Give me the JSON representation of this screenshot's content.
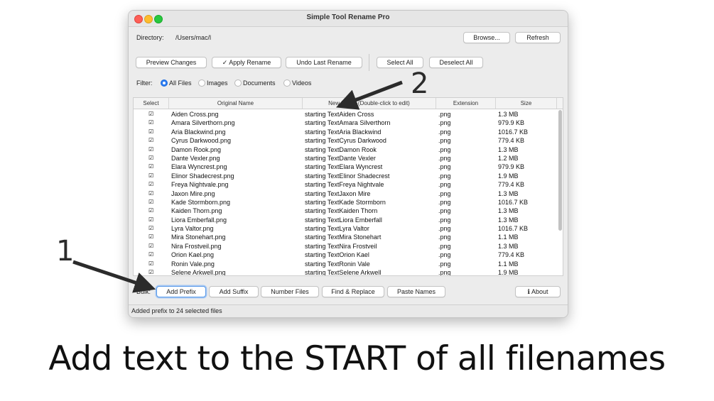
{
  "window": {
    "title": "Simple Tool Rename Pro"
  },
  "directory": {
    "label": "Directory:",
    "path": "/Users/mac/l"
  },
  "buttons": {
    "browse": "Browse...",
    "refresh": "Refresh",
    "preview": "Preview Changes",
    "apply": "✓ Apply Rename",
    "undo": "Undo Last Rename",
    "select_all": "Select All",
    "deselect_all": "Deselect All"
  },
  "filter": {
    "label": "Filter:",
    "options": [
      "All Files",
      "Images",
      "Documents",
      "Videos"
    ],
    "selected": "All Files"
  },
  "table": {
    "columns": [
      "Select",
      "Original Name",
      "New Name (Double-click to edit)",
      "Extension",
      "Size"
    ],
    "rows": [
      {
        "sel": "☑",
        "orig": "Aiden Cross.png",
        "new": "starting TextAiden Cross",
        "ext": ".png",
        "size": "1.3 MB"
      },
      {
        "sel": "☑",
        "orig": "Amara Silverthorn.png",
        "new": "starting TextAmara Silverthorn",
        "ext": ".png",
        "size": "979.9 KB"
      },
      {
        "sel": "☑",
        "orig": "Aria Blackwind.png",
        "new": "starting TextAria Blackwind",
        "ext": ".png",
        "size": "1016.7 KB"
      },
      {
        "sel": "☑",
        "orig": "Cyrus Darkwood.png",
        "new": "starting TextCyrus Darkwood",
        "ext": ".png",
        "size": "779.4 KB"
      },
      {
        "sel": "☑",
        "orig": "Damon Rook.png",
        "new": "starting TextDamon Rook",
        "ext": ".png",
        "size": "1.3 MB"
      },
      {
        "sel": "☑",
        "orig": "Dante Vexler.png",
        "new": "starting TextDante Vexler",
        "ext": ".png",
        "size": "1.2 MB"
      },
      {
        "sel": "☑",
        "orig": "Elara Wyncrest.png",
        "new": "starting TextElara Wyncrest",
        "ext": ".png",
        "size": "979.9 KB"
      },
      {
        "sel": "☑",
        "orig": "Elinor Shadecrest.png",
        "new": "starting TextElinor Shadecrest",
        "ext": ".png",
        "size": "1.9 MB"
      },
      {
        "sel": "☑",
        "orig": "Freya Nightvale.png",
        "new": "starting TextFreya Nightvale",
        "ext": ".png",
        "size": "779.4 KB"
      },
      {
        "sel": "☑",
        "orig": "Jaxon Mire.png",
        "new": "starting TextJaxon Mire",
        "ext": ".png",
        "size": "1.3 MB"
      },
      {
        "sel": "☑",
        "orig": "Kade Stormborn.png",
        "new": "starting TextKade Stormborn",
        "ext": ".png",
        "size": "1016.7 KB"
      },
      {
        "sel": "☑",
        "orig": "Kaiden Thorn.png",
        "new": "starting TextKaiden Thorn",
        "ext": ".png",
        "size": "1.3 MB"
      },
      {
        "sel": "☑",
        "orig": "Liora Emberfall.png",
        "new": "starting TextLiora Emberfall",
        "ext": ".png",
        "size": "1.3 MB"
      },
      {
        "sel": "☑",
        "orig": "Lyra Valtor.png",
        "new": "starting TextLyra Valtor",
        "ext": ".png",
        "size": "1016.7 KB"
      },
      {
        "sel": "☑",
        "orig": "Mira Stonehart.png",
        "new": "starting TextMira Stonehart",
        "ext": ".png",
        "size": "1.1 MB"
      },
      {
        "sel": "☑",
        "orig": "Nira Frostveil.png",
        "new": "starting TextNira Frostveil",
        "ext": ".png",
        "size": "1.3 MB"
      },
      {
        "sel": "☑",
        "orig": "Orion Kael.png",
        "new": "starting TextOrion Kael",
        "ext": ".png",
        "size": "779.4 KB"
      },
      {
        "sel": "☑",
        "orig": "Ronin Vale.png",
        "new": "starting TextRonin Vale",
        "ext": ".png",
        "size": "1.1 MB"
      },
      {
        "sel": "☑",
        "orig": "Selene Arkwell.png",
        "new": "starting TextSelene Arkwell",
        "ext": ".png",
        "size": "1.9 MB"
      }
    ]
  },
  "bulk": {
    "label": "Bulk:",
    "buttons": [
      "Add Prefix",
      "Add Suffix",
      "Number Files",
      "Find & Replace",
      "Paste Names"
    ],
    "about": "ℹ About"
  },
  "status": {
    "text": "Added prefix to 24 selected files"
  },
  "annotations": {
    "caption": "Add text to the START of all filenames",
    "marker_1": "1",
    "marker_2": "2"
  },
  "colors": {
    "accent": "#2a7af0",
    "arrow": "#2b2b2b"
  },
  "icons": {
    "checkbox": "checkbox-checked-icon",
    "radio": "radio-icon",
    "info": "info-icon"
  }
}
